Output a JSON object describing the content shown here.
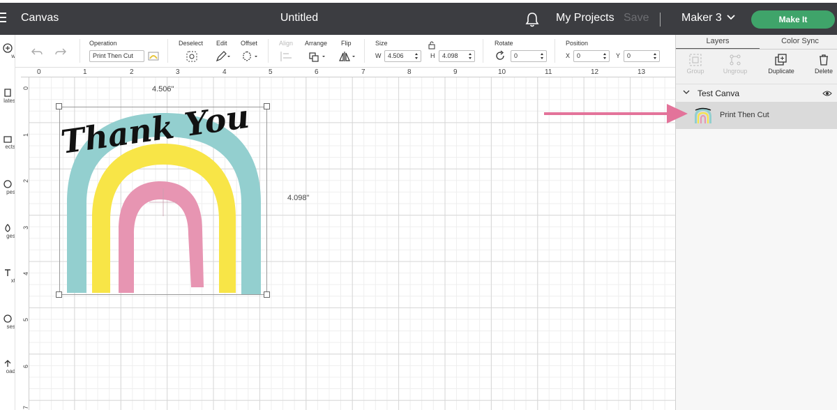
{
  "header": {
    "app_name": "Canvas",
    "doc_title": "Untitled",
    "my_projects": "My Projects",
    "save": "Save",
    "machine": "Maker 3",
    "make_it": "Make It"
  },
  "leftnav": {
    "items": [
      {
        "label": "w",
        "icon": "new-icon"
      },
      {
        "label": "lates",
        "icon": "templates-icon"
      },
      {
        "label": "ects",
        "icon": "projects-icon"
      },
      {
        "label": "pes",
        "icon": "shapes-icon"
      },
      {
        "label": "ges",
        "icon": "images-icon"
      },
      {
        "label": "xt",
        "icon": "text-icon"
      },
      {
        "label": "ses",
        "icon": "phrases-icon"
      },
      {
        "label": "oad",
        "icon": "upload-icon"
      }
    ]
  },
  "toolbar": {
    "operation_label": "Operation",
    "operation_value": "Print Then Cut",
    "deselect_label": "Deselect",
    "edit_label": "Edit",
    "offset_label": "Offset",
    "align_label": "Align",
    "arrange_label": "Arrange",
    "flip_label": "Flip",
    "size_label": "Size",
    "w_label": "W",
    "w_value": "4.506",
    "h_label": "H",
    "h_value": "4.098",
    "rotate_label": "Rotate",
    "rotate_value": "0",
    "position_label": "Position",
    "x_label": "X",
    "x_value": "0",
    "y_label": "Y",
    "y_value": "0"
  },
  "ruler": {
    "top_ticks": [
      "0",
      "1",
      "2",
      "3",
      "4",
      "5",
      "6",
      "7",
      "8",
      "9",
      "10",
      "11",
      "12",
      "13"
    ],
    "left_ticks": [
      "0",
      "1",
      "2",
      "3",
      "4",
      "5",
      "6",
      "7"
    ]
  },
  "canvas": {
    "width_dim": "4.506\"",
    "height_dim": "4.098\"",
    "artwork_text": "Thank You"
  },
  "panel": {
    "tab_layers": "Layers",
    "tab_color_sync": "Color Sync",
    "group_label": "Group",
    "ungroup_label": "Ungroup",
    "duplicate_label": "Duplicate",
    "delete_label": "Delete",
    "group_name": "Test Canva",
    "layer_name": "Print Then Cut"
  },
  "colors": {
    "header_bg": "#3c3d41",
    "make_it": "#3fa46a",
    "arrow": "#e3739a",
    "rainbow_teal": "#93cfcf",
    "rainbow_yellow": "#f8e547",
    "rainbow_pink": "#e795b2"
  }
}
